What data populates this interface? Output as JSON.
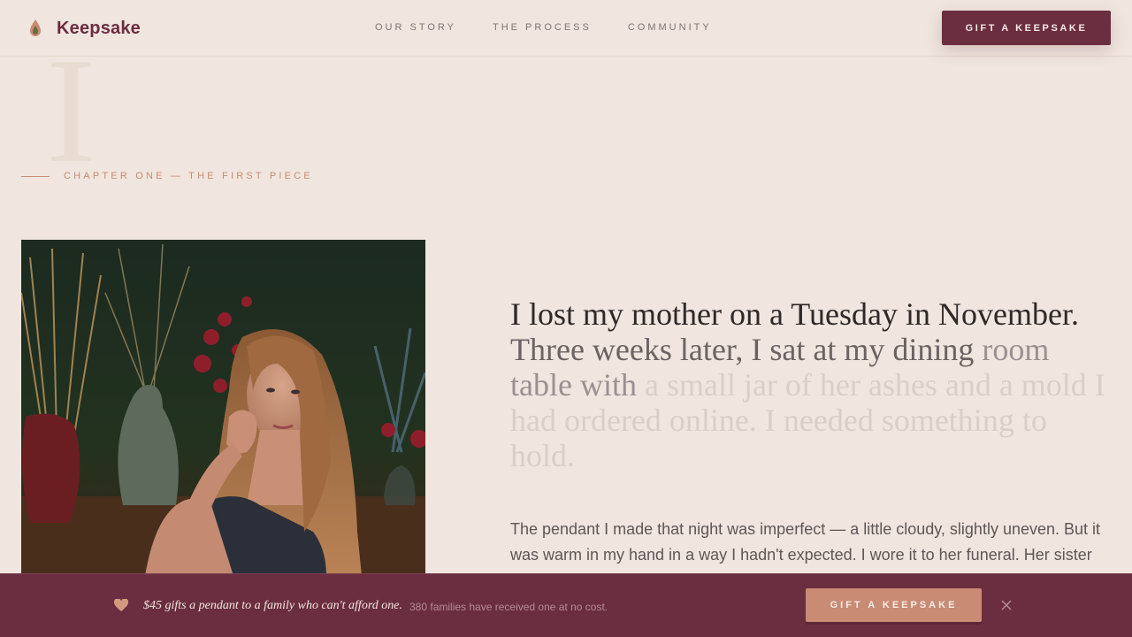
{
  "brand": {
    "name": "Keepsake",
    "logo_icon": "flame-drop-icon"
  },
  "nav": {
    "items": [
      "OUR STORY",
      "THE PROCESS",
      "COMMUNITY"
    ]
  },
  "header": {
    "cta_label": "GIFT A KEEPSAKE"
  },
  "chapter": {
    "dropcap": "I",
    "label": "CHAPTER ONE — THE FIRST PIECE"
  },
  "story": {
    "lead_parts": [
      "I lost my mother on a Tuesday in November.",
      "Three weeks later, I sat at my dining",
      "room table with",
      "a small jar of her ashes and a mold I had ordered online. I needed something to hold."
    ],
    "body": "The pendant I made that night was imperfect — a little cloudy, slightly uneven. But it was warm in my hand in a way I hadn't expected. I wore it to her funeral. Her sister"
  },
  "banner": {
    "icon": "heart-icon",
    "main": "$45 gifts a pendant to a family who can't afford one.",
    "sub": "380 families have received one at no cost.",
    "cta_label": "GIFT A KEEPSAKE",
    "close_icon": "close-icon"
  },
  "colors": {
    "background": "#f0e6df",
    "brand": "#6b2d40",
    "accent": "#c98b73",
    "text": "#2e2828"
  }
}
